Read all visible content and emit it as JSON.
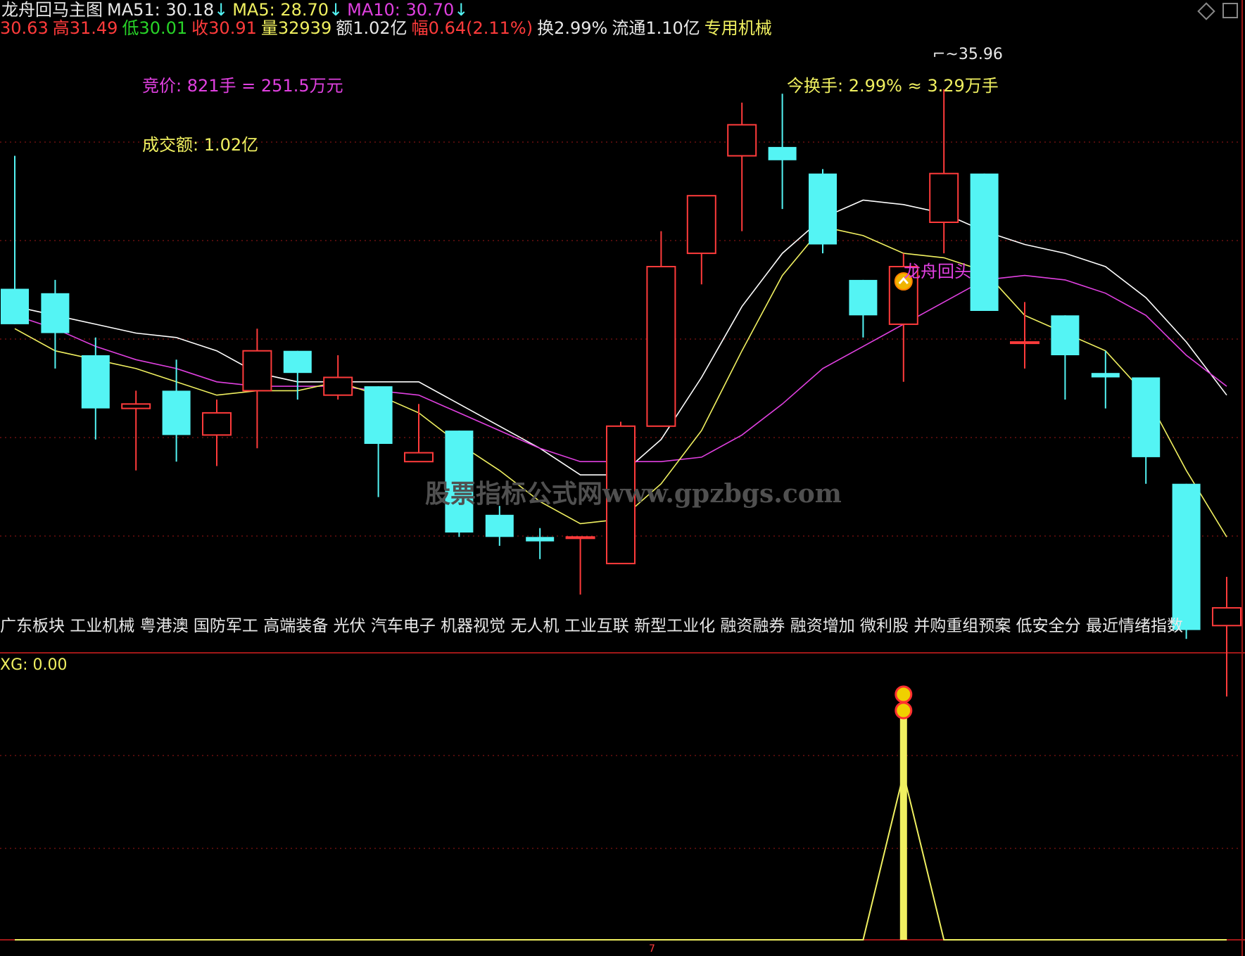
{
  "colors": {
    "up": "#ff3b3b",
    "down": "#54f4f4",
    "ma5": "#f0f060",
    "ma10": "#e040e0",
    "ma51": "#ffffff",
    "grid": "#a01818",
    "white": "#e8e8e8",
    "yellow": "#f0f060",
    "magenta": "#e040e0",
    "green": "#28d428",
    "watermark": "#505050"
  },
  "header": {
    "title": "龙舟回马主图",
    "ma51": "MA51: 30.18",
    "ma5": "MA5: 28.70",
    "ma10": "MA10: 30.70",
    "arrow": "↓",
    "open": "30.63",
    "high": "高31.49",
    "low": "低30.01",
    "close": "收30.91",
    "volume": "量32939",
    "amount": "额1.02亿",
    "change": "幅0.64(2.11%)",
    "turnover": "换2.99%",
    "float": "流通1.10亿",
    "industry": "专用机械"
  },
  "annotations": {
    "auction": "竞价: 821手 = 251.5万元",
    "turnover_amount": "成交额: 1.02亿",
    "today_turnover": "今换手: 2.99% ≈ 3.29万手",
    "high_price": "35.96",
    "signal_label": "龙舟回头",
    "watermark": "股票指标公式网www.gpzbgs.com"
  },
  "concepts": "广东板块 工业机械 粤港澳 国防军工 高端装备 光伏 汽车电子 机器视觉 无人机 工业互联 新型工业化 融资融券 融资增加 微利股 并购重组预案 低安全分 最近情绪指数",
  "lower_panel": {
    "label": "XG: 0.00",
    "axis_marker": "7"
  },
  "corner_icons": [
    "diamond-icon",
    "square-icon"
  ],
  "chart_data": {
    "type": "candlestick",
    "price_axis": {
      "min": 24.9,
      "max": 36.9
    },
    "candles": [
      {
        "o": 31.4,
        "h": 34.4,
        "l": 30.6,
        "c": 30.6
      },
      {
        "o": 31.3,
        "h": 31.6,
        "l": 29.6,
        "c": 30.4
      },
      {
        "o": 29.9,
        "h": 30.3,
        "l": 28.0,
        "c": 28.7
      },
      {
        "o": 28.7,
        "h": 29.1,
        "l": 27.3,
        "c": 28.8
      },
      {
        "o": 29.1,
        "h": 29.8,
        "l": 27.5,
        "c": 28.1
      },
      {
        "o": 28.1,
        "h": 28.9,
        "l": 27.4,
        "c": 28.6
      },
      {
        "o": 29.1,
        "h": 30.5,
        "l": 27.8,
        "c": 30.0
      },
      {
        "o": 30.0,
        "h": 30.0,
        "l": 28.9,
        "c": 29.5
      },
      {
        "o": 29.0,
        "h": 29.9,
        "l": 28.9,
        "c": 29.4
      },
      {
        "o": 29.2,
        "h": 29.2,
        "l": 26.7,
        "c": 27.9
      },
      {
        "o": 27.5,
        "h": 28.8,
        "l": 27.5,
        "c": 27.7
      },
      {
        "o": 28.2,
        "h": 28.2,
        "l": 25.8,
        "c": 25.9
      },
      {
        "o": 26.3,
        "h": 26.5,
        "l": 25.6,
        "c": 25.8
      },
      {
        "o": 25.8,
        "h": 26.0,
        "l": 25.3,
        "c": 25.7
      },
      {
        "o": 25.8,
        "h": 25.8,
        "l": 24.5,
        "c": 25.8
      },
      {
        "o": 25.2,
        "h": 28.4,
        "l": 25.2,
        "c": 28.3
      },
      {
        "o": 28.3,
        "h": 32.7,
        "l": 28.3,
        "c": 31.9
      },
      {
        "o": 32.2,
        "h": 33.3,
        "l": 31.5,
        "c": 33.5
      },
      {
        "o": 34.4,
        "h": 35.6,
        "l": 32.7,
        "c": 35.1
      },
      {
        "o": 34.6,
        "h": 35.8,
        "l": 33.2,
        "c": 34.3
      },
      {
        "o": 34.0,
        "h": 34.1,
        "l": 32.2,
        "c": 32.4
      },
      {
        "o": 31.6,
        "h": 31.6,
        "l": 30.3,
        "c": 30.8
      },
      {
        "o": 30.6,
        "h": 32.2,
        "l": 29.3,
        "c": 31.9
      },
      {
        "o": 32.9,
        "h": 35.9,
        "l": 32.2,
        "c": 34.0
      },
      {
        "o": 34.0,
        "h": 34.0,
        "l": 30.9,
        "c": 30.9
      },
      {
        "o": 30.2,
        "h": 31.1,
        "l": 29.6,
        "c": 30.2
      },
      {
        "o": 30.8,
        "h": 30.8,
        "l": 28.9,
        "c": 29.9
      },
      {
        "o": 29.5,
        "h": 30.0,
        "l": 28.7,
        "c": 29.4
      },
      {
        "o": 29.4,
        "h": 29.4,
        "l": 27.0,
        "c": 27.6
      },
      {
        "o": 27.0,
        "h": 27.0,
        "l": 23.5,
        "c": 23.7
      },
      {
        "o": 23.8,
        "h": 24.9,
        "l": 22.2,
        "c": 24.2
      }
    ],
    "ma5": [
      30.5,
      30.0,
      29.8,
      29.6,
      29.3,
      29.0,
      29.1,
      29.1,
      29.3,
      29.0,
      28.6,
      27.9,
      27.3,
      26.6,
      26.1,
      26.2,
      27.0,
      28.2,
      30.0,
      31.7,
      32.8,
      32.6,
      32.2,
      32.1,
      31.8,
      30.8,
      30.4,
      30.0,
      29.0,
      27.3,
      25.8
    ],
    "ma10": [
      30.8,
      30.5,
      30.1,
      29.8,
      29.6,
      29.3,
      29.2,
      29.2,
      29.2,
      29.1,
      29.0,
      28.6,
      28.2,
      27.8,
      27.5,
      27.5,
      27.5,
      27.6,
      28.1,
      28.8,
      29.6,
      30.1,
      30.6,
      31.1,
      31.6,
      31.7,
      31.6,
      31.3,
      30.8,
      29.9,
      29.2
    ],
    "ma51": [
      31.0,
      30.8,
      30.6,
      30.4,
      30.3,
      30.0,
      29.5,
      29.3,
      29.3,
      29.3,
      29.3,
      28.8,
      28.3,
      27.8,
      27.2,
      27.2,
      28.0,
      29.4,
      31.0,
      32.2,
      33.0,
      33.4,
      33.3,
      33.1,
      32.7,
      32.4,
      32.2,
      31.9,
      31.2,
      30.2,
      29.0
    ],
    "signal_index": 22,
    "xg_values": [
      0,
      0,
      0,
      0,
      0,
      0,
      0,
      0,
      0,
      0,
      0,
      0,
      0,
      0,
      0,
      0,
      0,
      0,
      0,
      0,
      0,
      0,
      1,
      0,
      0,
      0,
      0,
      0,
      0,
      0,
      0
    ]
  }
}
